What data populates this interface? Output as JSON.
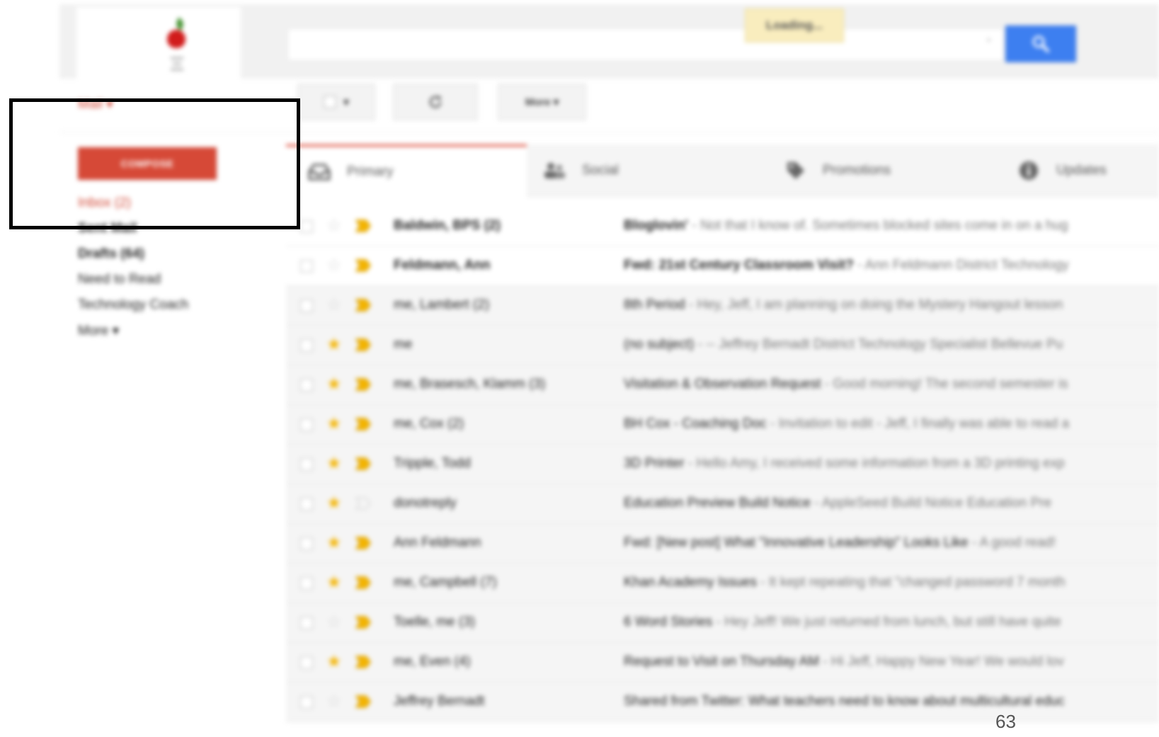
{
  "header": {
    "loading_text": "Loading...",
    "search_placeholder": "",
    "search_icon": "search-icon"
  },
  "toolbar": {
    "mail_label": "Mail ▾",
    "select_caret": "▾",
    "refresh_icon": "refresh-icon",
    "more_label": "More ▾"
  },
  "sidebar": {
    "compose_label": "COMPOSE",
    "items": [
      {
        "label": "Inbox (2)"
      },
      {
        "label": "Sent Mail"
      },
      {
        "label": "Drafts (64)"
      },
      {
        "label": "Need to Read"
      },
      {
        "label": "Technology Coach"
      },
      {
        "label": "More ▾"
      }
    ]
  },
  "tabs": [
    {
      "label": "Primary",
      "icon": "inbox-icon"
    },
    {
      "label": "Social",
      "icon": "people-icon"
    },
    {
      "label": "Promotions",
      "icon": "tag-icon"
    },
    {
      "label": "Updates",
      "icon": "info-icon"
    }
  ],
  "messages": [
    {
      "sender": "Baldwin, BPS (2)",
      "subject": "Bloglovin'",
      "snippet": " - Not that I know of. Sometimes blocked sites come in on a hug",
      "starred": false,
      "important": true,
      "unread": true
    },
    {
      "sender": "Feldmann, Ann",
      "subject": "Fwd: 21st Century Classroom Visit?",
      "snippet": " - Ann Feldmann District Technology",
      "starred": false,
      "important": true,
      "unread": true
    },
    {
      "sender": "me, Lambert (2)",
      "subject": "8th Period",
      "snippet": " - Hey, Jeff, I am planning on doing the Mystery Hangout lesson",
      "starred": false,
      "important": true,
      "unread": false
    },
    {
      "sender": "me",
      "subject": "(no subject)",
      "snippet": " - -- Jeffrey Bernadt District Technology Specialist Bellevue Pu",
      "starred": true,
      "important": true,
      "unread": false
    },
    {
      "sender": "me, Brasesch, Klamm (3)",
      "subject": "Visitation & Observation Request",
      "snippet": " - Good morning! The second semester is",
      "starred": true,
      "important": true,
      "unread": false
    },
    {
      "sender": "me, Cox (2)",
      "subject": "BH Cox - Coaching Doc",
      "snippet": " - Invitation to edit - Jeff, I finally was able to read a",
      "starred": true,
      "important": true,
      "unread": false
    },
    {
      "sender": "Tripple, Todd",
      "subject": "3D Printer",
      "snippet": " - Hello Amy, I received some information from a 3D printing exp",
      "starred": true,
      "important": true,
      "unread": false
    },
    {
      "sender": "donotreply",
      "subject": "Education Preview Build Notice",
      "snippet": " - AppleSeed Build Notice Education Pre",
      "starred": true,
      "important": false,
      "unread": false
    },
    {
      "sender": "Ann Feldmann",
      "subject": "Fwd: [New post] What \"Innovative Leadership\" Looks Like",
      "snippet": " - A good read!",
      "starred": true,
      "important": true,
      "unread": false
    },
    {
      "sender": "me, Campbell (7)",
      "subject": "Khan Academy Issues",
      "snippet": " - It kept repeating that \"changed password 7 month",
      "starred": true,
      "important": true,
      "unread": false
    },
    {
      "sender": "Toelle, me (3)",
      "subject": "6 Word Stories",
      "snippet": " - Hey Jeff! We just returned from lunch, but still have quite",
      "starred": false,
      "important": true,
      "unread": false
    },
    {
      "sender": "me, Even (4)",
      "subject": "Request to Visit on Thursday AM",
      "snippet": " - Hi Jeff, Happy New Year! We would lov",
      "starred": true,
      "important": true,
      "unread": false
    },
    {
      "sender": "Jeffrey Bernadt",
      "subject": "Shared from Twitter: What teachers need to know about multicultural educ",
      "snippet": "",
      "starred": false,
      "important": true,
      "unread": false
    }
  ],
  "colors": {
    "accent_red": "#d14836",
    "compose_red": "#d64937",
    "search_blue": "#3d7ff0",
    "star_yellow": "#f4b400",
    "loading_bg": "#f9edbe"
  },
  "slide": {
    "page_number": "63"
  }
}
